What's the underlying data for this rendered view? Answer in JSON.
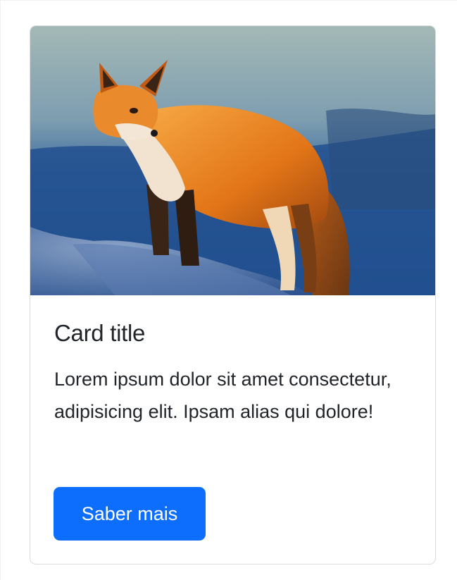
{
  "card": {
    "image": {
      "description_icon": "fox-photo-image",
      "colors": {
        "sky_top": "#9fb6b5",
        "sky_mid": "#5f86a5",
        "water": "#1d4f8f",
        "snow": "#6f88b3",
        "fur": "#e07a1c",
        "fur_light": "#f5a14a",
        "chest": "#f1e3cf",
        "legs": "#3a2416"
      }
    },
    "title": "Card title",
    "text": "Lorem ipsum dolor sit amet consectetur, adipisicing elit. Ipsam alias qui dolore!",
    "button_label": "Saber mais",
    "button_color": "#0d6efd"
  }
}
